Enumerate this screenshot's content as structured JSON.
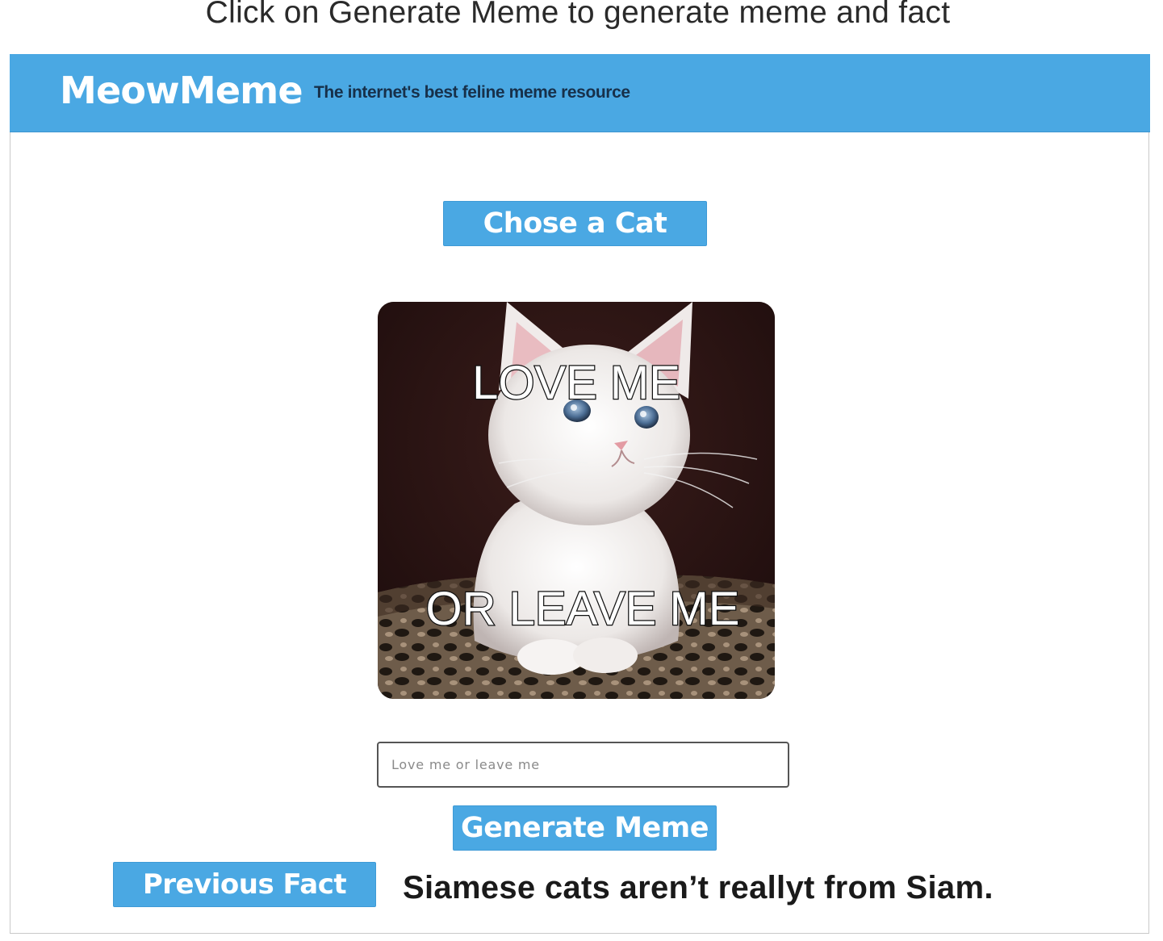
{
  "instruction": "Click on Generate Meme to generate meme and fact",
  "header": {
    "brand": "MeowMeme",
    "tagline": "The internet's best feline meme resource",
    "background_color": "#4aa8e3"
  },
  "chose_cat_button": {
    "label": "Chose a Cat"
  },
  "meme": {
    "image_subject": "white kitten sitting on leopard-print blanket",
    "top_text": "LOVE ME",
    "bottom_text": "OR LEAVE ME"
  },
  "caption_input": {
    "value": "",
    "placeholder": "Love me or leave me"
  },
  "generate_button": {
    "label": "Generate Meme"
  },
  "previous_fact_button": {
    "label": "Previous Fact"
  },
  "fact_text": "Siamese cats aren’t reallyt from Siam.",
  "colors": {
    "accent": "#4aa8e3",
    "button_text": "#ffffff",
    "tagline_text": "#17304a"
  }
}
